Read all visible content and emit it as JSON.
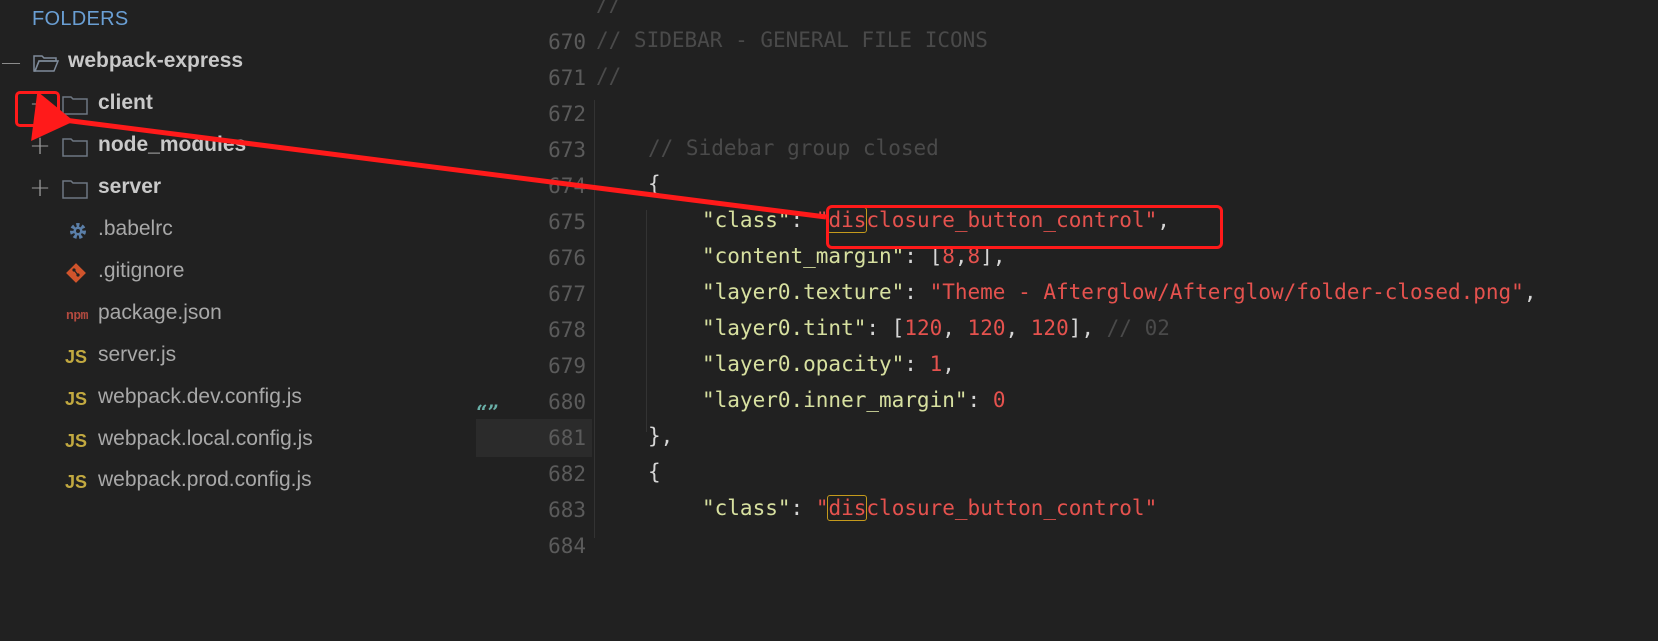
{
  "sidebar": {
    "header": "FOLDERS",
    "root": {
      "toggle": "—",
      "label": "webpack-express"
    },
    "items": [
      {
        "type": "folder",
        "toggle": "+",
        "label": "client"
      },
      {
        "type": "folder",
        "toggle": "+",
        "label": "node_modules"
      },
      {
        "type": "folder",
        "toggle": "+",
        "label": "server"
      },
      {
        "type": "file",
        "icon": "gear-icon",
        "label": ".babelrc"
      },
      {
        "type": "file",
        "icon": "git-icon",
        "label": ".gitignore"
      },
      {
        "type": "file",
        "icon": "npm-icon",
        "badge": "npm",
        "label": "package.json"
      },
      {
        "type": "file",
        "icon": "js-icon",
        "badge": "JS",
        "label": "server.js"
      },
      {
        "type": "file",
        "icon": "js-icon",
        "badge": "JS",
        "label": "webpack.dev.config.js"
      },
      {
        "type": "file",
        "icon": "js-icon",
        "badge": "JS",
        "label": "webpack.local.config.js"
      },
      {
        "type": "file",
        "icon": "js-icon",
        "badge": "JS",
        "label": "webpack.prod.config.js"
      }
    ]
  },
  "editor": {
    "gutter_marker": "“”",
    "lines": [
      {
        "n": "670",
        "text": "//"
      },
      {
        "n": "671",
        "text": "// SIDEBAR - GENERAL FILE ICONS"
      },
      {
        "n": "672",
        "text": "//"
      },
      {
        "n": "673",
        "text": ""
      },
      {
        "n": "674",
        "text": "// Sidebar group closed"
      },
      {
        "n": "675",
        "text": "{"
      },
      {
        "n": "676",
        "key": "\"class\"",
        "sep": ": ",
        "q": "\"",
        "match": "dis",
        "rest": "closure_button_control",
        "q2": "\"",
        "end": ","
      },
      {
        "n": "677",
        "key": "\"content_margin\"",
        "sep": ": [",
        "v1": "8",
        "comma": ",",
        "v2": "8",
        "end": "],"
      },
      {
        "n": "678",
        "key": "\"layer0.texture\"",
        "sep": ": ",
        "str": "\"Theme - Afterglow/Afterglow/folder-closed.png\"",
        "end": ","
      },
      {
        "n": "679",
        "key": "\"layer0.tint\"",
        "sep": ": [",
        "v1": "120",
        "c1": ", ",
        "v2": "120",
        "c2": ", ",
        "v3": "120",
        "end": "], ",
        "comment": "// 02"
      },
      {
        "n": "680",
        "key": "\"layer0.opacity\"",
        "sep": ": ",
        "v1": "1",
        "end": ","
      },
      {
        "n": "681",
        "key": "\"layer0.inner_margin\"",
        "sep": ": ",
        "v1": "0"
      },
      {
        "n": "682",
        "text": "},"
      },
      {
        "n": "683",
        "text": "{"
      },
      {
        "n": "684",
        "key": "\"class\"",
        "sep": ": ",
        "q": "\"",
        "match": "dis",
        "rest": "closure_button_control",
        "q2": "\""
      }
    ]
  },
  "colors": {
    "background": "#212121",
    "annotation": "#ff1a1a",
    "string": "#e5524e",
    "key": "#d7e0a0",
    "comment": "#4a4a4a",
    "folders_header": "#6a9fd4"
  }
}
